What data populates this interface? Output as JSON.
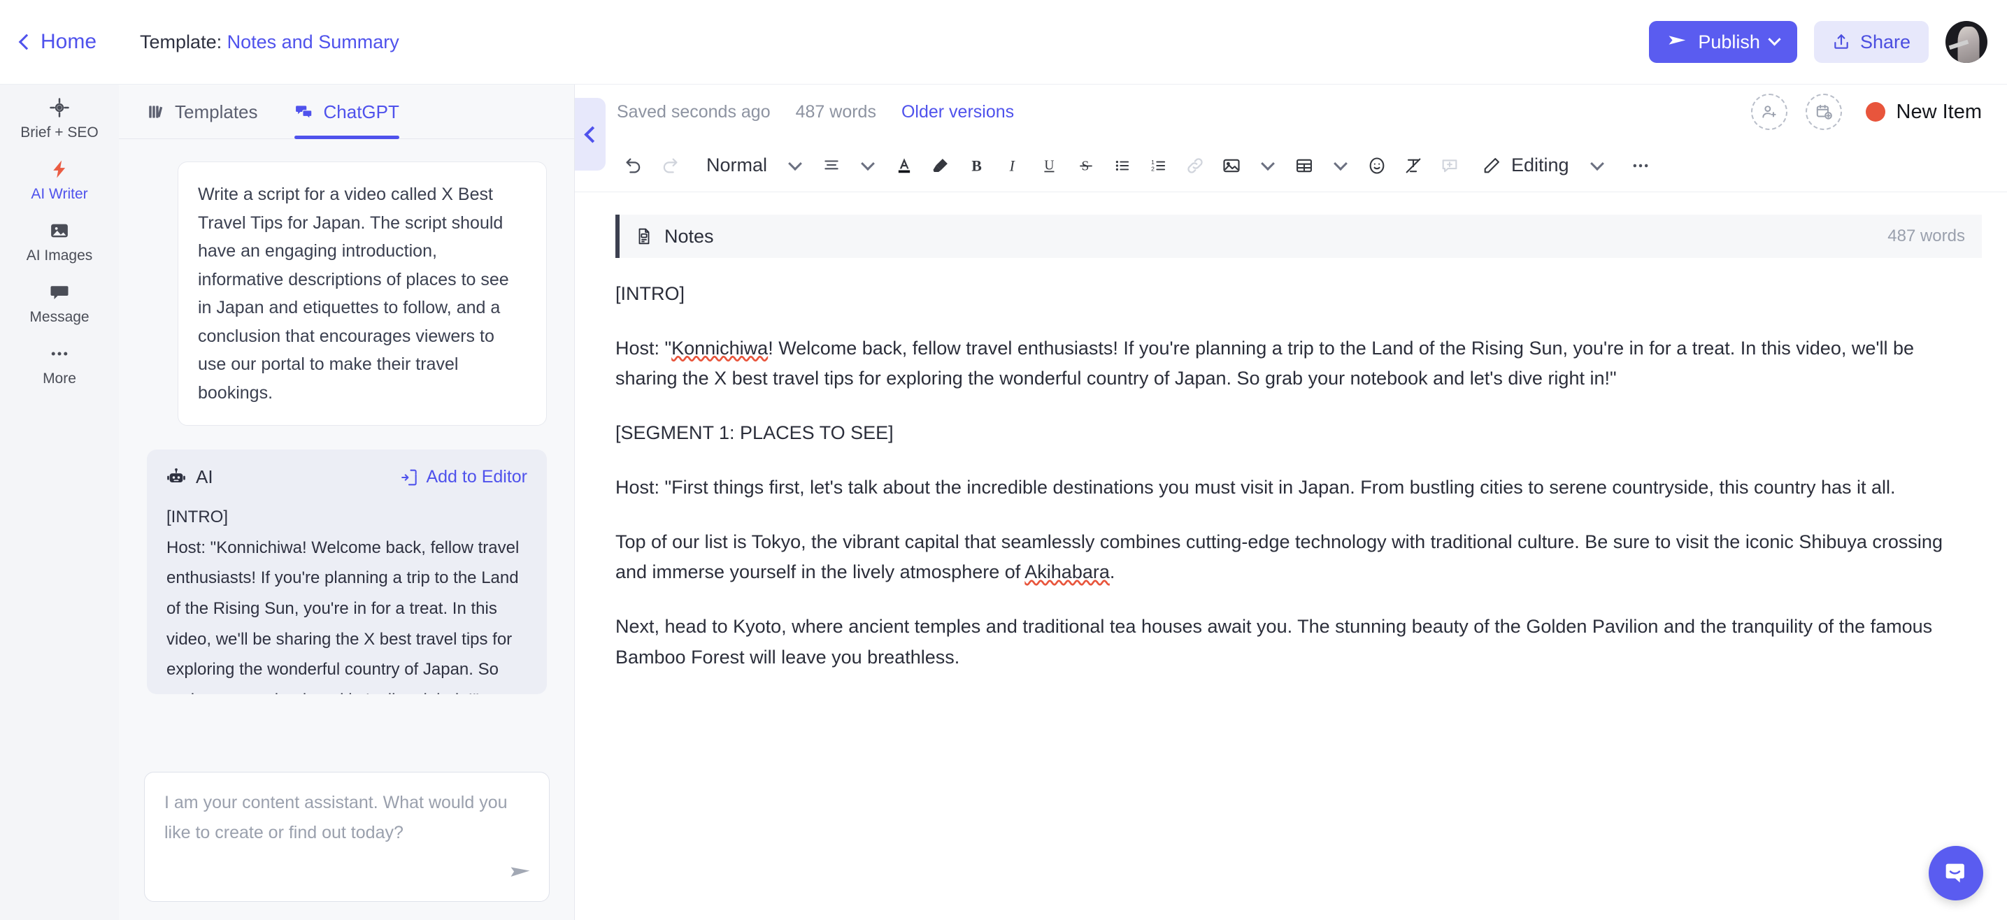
{
  "topbar": {
    "home_label": "Home",
    "template_prefix": "Template:",
    "template_name": "Notes and Summary",
    "publish_label": "Publish",
    "share_label": "Share",
    "accent_color": "#5a5cf0"
  },
  "rail": {
    "items": [
      {
        "label": "Brief + SEO",
        "icon": "target-icon",
        "active": false
      },
      {
        "label": "AI Writer",
        "icon": "lightning-bolt-icon",
        "active": true
      },
      {
        "label": "AI Images",
        "icon": "image-icon",
        "active": false
      },
      {
        "label": "Message",
        "icon": "chat-bubble-icon",
        "active": false
      },
      {
        "label": "More",
        "icon": "ellipsis-icon",
        "active": false
      }
    ]
  },
  "ai_panel": {
    "tabs": [
      {
        "label": "Templates",
        "icon": "books-icon",
        "active": false
      },
      {
        "label": "ChatGPT",
        "icon": "chat-bubbles-icon",
        "active": true
      }
    ],
    "collapse_icon": "chevron-left-icon",
    "user_prompt": "Write a script for a video called X Best Travel Tips for Japan. The script should have an engaging introduction, informative descriptions of places to see in Japan and etiquettes to follow, and a conclusion that encourages viewers to use our portal to make their travel bookings.",
    "ai_label": "AI",
    "ai_icon": "robot-icon",
    "add_to_editor_label": "Add to Editor",
    "add_to_editor_icon": "add-to-document-icon",
    "ai_response": "[INTRO]\nHost: \"Konnichiwa! Welcome back, fellow travel enthusiasts! If you're planning a trip to the Land of the Rising Sun, you're in for a treat. In this video, we'll be sharing the X best travel tips for exploring the wonderful country of Japan. So grab your notebook and let's dive right in!\"",
    "composer_placeholder": "I am your content assistant. What would you like to create or find out today?",
    "send_icon": "send-icon"
  },
  "editor": {
    "saved_status": "Saved seconds ago",
    "word_count": "487 words",
    "older_versions_label": "Older versions",
    "add_person_icon": "add-person-icon",
    "add_calendar_icon": "add-calendar-icon",
    "new_item_label": "New Item",
    "new_item_color": "#e8553c",
    "toolbar": {
      "undo_icon": "undo-icon",
      "redo_icon": "redo-icon",
      "style_label": "Normal",
      "style_caret_icon": "chevron-down-icon",
      "align_icon": "align-icon",
      "align_caret_icon": "chevron-down-icon",
      "text_color_icon": "text-color-icon",
      "highlight_icon": "highlighter-icon",
      "bold_icon": "bold-icon",
      "italic_icon": "italic-icon",
      "underline_icon": "underline-icon",
      "strikethrough_icon": "strikethrough-icon",
      "bullet_list_icon": "bullet-list-icon",
      "numbered_list_icon": "numbered-list-icon",
      "link_icon": "link-icon",
      "image_icon": "image-icon",
      "image_caret_icon": "chevron-down-icon",
      "table_icon": "table-icon",
      "table_caret_icon": "chevron-down-icon",
      "emoji_icon": "emoji-icon",
      "clear_format_icon": "clear-formatting-icon",
      "comment_icon": "add-comment-icon",
      "editing_icon": "pencil-icon",
      "editing_label": "Editing",
      "editing_caret_icon": "chevron-down-icon",
      "more_icon": "ellipsis-icon"
    },
    "section": {
      "icon": "document-icon",
      "title": "Notes",
      "word_count": "487 words"
    },
    "document": {
      "p1": "[INTRO]",
      "p2_pre": "Host: \"",
      "p2_misspelled": "Konnichiwa",
      "p2_post": "! Welcome back, fellow travel enthusiasts! If you're planning a trip to the Land of the Rising Sun, you're in for a treat. In this video, we'll be sharing the X best travel tips for exploring the wonderful country of Japan. So grab your notebook and let's dive right in!\"",
      "p3": "[SEGMENT 1: PLACES TO SEE]",
      "p4": "Host: \"First things first, let's talk about the incredible destinations you must visit in Japan. From bustling cities to serene countryside, this country has it all.",
      "p5_pre": "Top of our list is Tokyo, the vibrant capital that seamlessly combines cutting-edge technology with traditional culture. Be sure to visit the iconic Shibuya crossing and immerse yourself in the lively atmosphere of ",
      "p5_misspelled": "Akihabara",
      "p5_post": ".",
      "p6": "Next, head to Kyoto, where ancient temples and traditional tea houses await you. The stunning beauty of the Golden Pavilion and the tranquility of the famous Bamboo Forest will leave you breathless."
    }
  },
  "intercom": {
    "icon": "intercom-chat-icon"
  }
}
